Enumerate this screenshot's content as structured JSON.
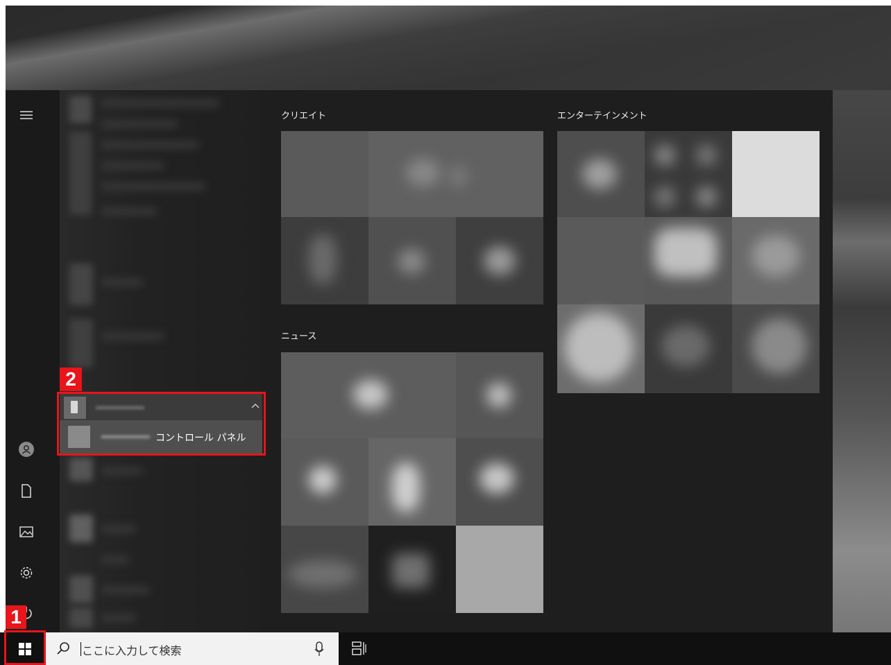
{
  "start_menu": {
    "groups": {
      "create": "クリエイト",
      "entertainment": "エンターテインメント",
      "news": "ニュース"
    },
    "highlighted_app": {
      "item_label": "コントロール パネル"
    },
    "rail_icons": [
      "hamburger-menu-icon",
      "user-avatar-icon",
      "documents-icon",
      "pictures-icon",
      "settings-icon",
      "power-icon"
    ]
  },
  "annotations": {
    "step1": "1",
    "step2": "2",
    "highlight_color": "#e8151b"
  },
  "taskbar": {
    "search_placeholder": "ここに入力して検索",
    "icons": [
      "windows-start-icon",
      "search-icon",
      "microphone-icon",
      "task-view-icon"
    ]
  }
}
